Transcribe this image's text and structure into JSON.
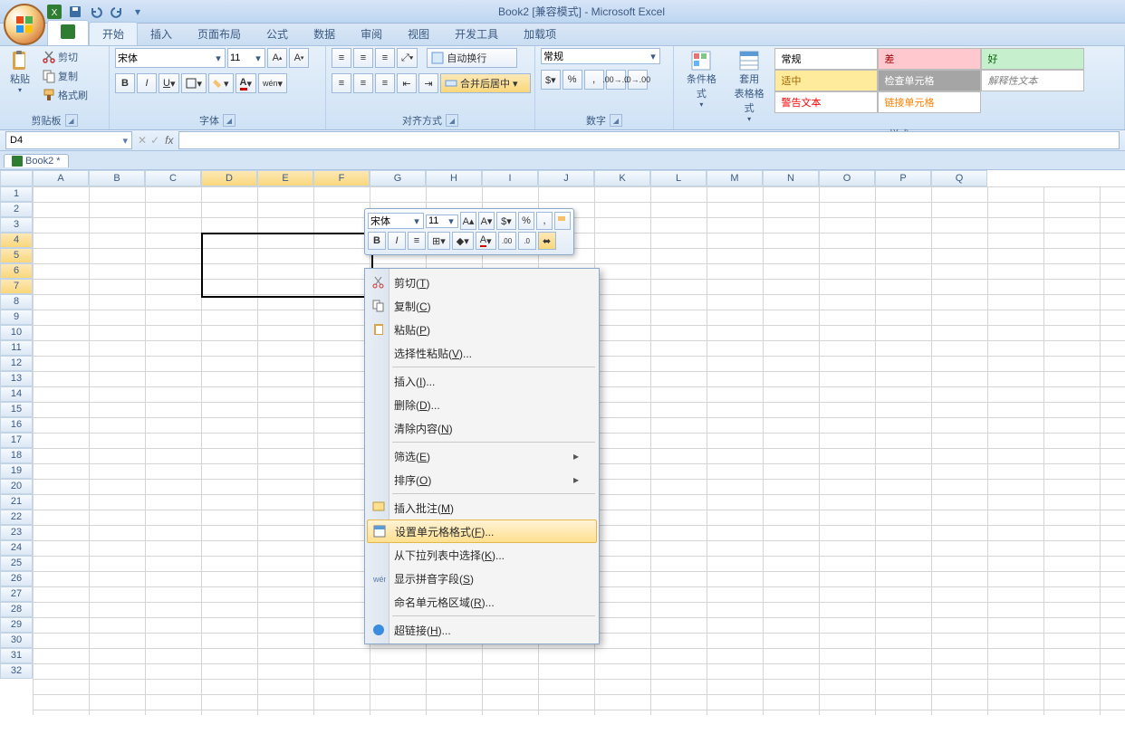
{
  "title": "Book2  [兼容模式] - Microsoft Excel",
  "ribbon_tabs": [
    "开始",
    "插入",
    "页面布局",
    "公式",
    "数据",
    "审阅",
    "视图",
    "开发工具",
    "加载项"
  ],
  "clipboard": {
    "paste": "粘贴",
    "cut": "剪切",
    "copy": "复制",
    "format_painter": "格式刷",
    "group": "剪贴板"
  },
  "font": {
    "name": "宋体",
    "size": "11",
    "group": "字体"
  },
  "align": {
    "wrap": "自动换行",
    "merge": "合并后居中",
    "group": "对齐方式"
  },
  "number": {
    "format": "常规",
    "group": "数字"
  },
  "cond": {
    "label": "条件格式"
  },
  "tablefmt": {
    "label": "套用\n表格格式"
  },
  "styles_group": "样式",
  "style_cells": [
    {
      "t": "常规",
      "bg": "#ffffff",
      "fg": "#000"
    },
    {
      "t": "差",
      "bg": "#ffc7ce",
      "fg": "#9c0006"
    },
    {
      "t": "好",
      "bg": "#c6efce",
      "fg": "#006100"
    },
    {
      "t": "适中",
      "bg": "#ffeb9c",
      "fg": "#9c6500"
    },
    {
      "t": "检查单元格",
      "bg": "#a5a5a5",
      "fg": "#fff"
    },
    {
      "t": "解释性文本",
      "bg": "#ffffff",
      "fg": "#7f7f7f",
      "italic": true
    },
    {
      "t": "警告文本",
      "bg": "#ffffff",
      "fg": "#ff0000"
    },
    {
      "t": "链接单元格",
      "bg": "#ffffff",
      "fg": "#ff8001"
    }
  ],
  "namebox": "D4",
  "wb_tab": "Book2 *",
  "columns": [
    "A",
    "B",
    "C",
    "D",
    "E",
    "F",
    "G",
    "H",
    "I",
    "J",
    "K",
    "L",
    "M",
    "N",
    "O",
    "P",
    "Q"
  ],
  "rows": [
    "1",
    "2",
    "3",
    "4",
    "5",
    "6",
    "7",
    "8",
    "9",
    "10",
    "11",
    "12",
    "13",
    "14",
    "15",
    "16",
    "17",
    "18",
    "19",
    "20",
    "21",
    "22",
    "23",
    "24",
    "25",
    "26",
    "27",
    "28",
    "29",
    "30",
    "31",
    "32"
  ],
  "sel_cols": [
    "D",
    "E",
    "F"
  ],
  "sel_rows": [
    "4",
    "5",
    "6",
    "7"
  ],
  "mini": {
    "font": "宋体",
    "size": "11"
  },
  "ctx": [
    {
      "t": "剪切",
      "k": "T",
      "ico": "cut"
    },
    {
      "t": "复制",
      "k": "C",
      "ico": "copy"
    },
    {
      "t": "粘贴",
      "k": "P",
      "ico": "paste"
    },
    {
      "t": "选择性粘贴",
      "k": "V",
      "more": true
    },
    {
      "sep": true
    },
    {
      "t": "插入",
      "k": "I",
      "more": true
    },
    {
      "t": "删除",
      "k": "D",
      "more": true
    },
    {
      "t": "清除内容",
      "k": "N"
    },
    {
      "sep": true
    },
    {
      "t": "筛选",
      "k": "E",
      "sub": true
    },
    {
      "t": "排序",
      "k": "O",
      "sub": true
    },
    {
      "sep": true
    },
    {
      "t": "插入批注",
      "k": "M",
      "ico": "comment"
    },
    {
      "t": "设置单元格格式",
      "k": "F",
      "more": true,
      "ico": "fmt",
      "hl": true
    },
    {
      "t": "从下拉列表中选择",
      "k": "K",
      "more": true
    },
    {
      "t": "显示拼音字段",
      "k": "S",
      "ico": "pinyin"
    },
    {
      "t": "命名单元格区域",
      "k": "R",
      "more": true
    },
    {
      "sep": true
    },
    {
      "t": "超链接",
      "k": "H",
      "more": true,
      "ico": "link"
    }
  ]
}
